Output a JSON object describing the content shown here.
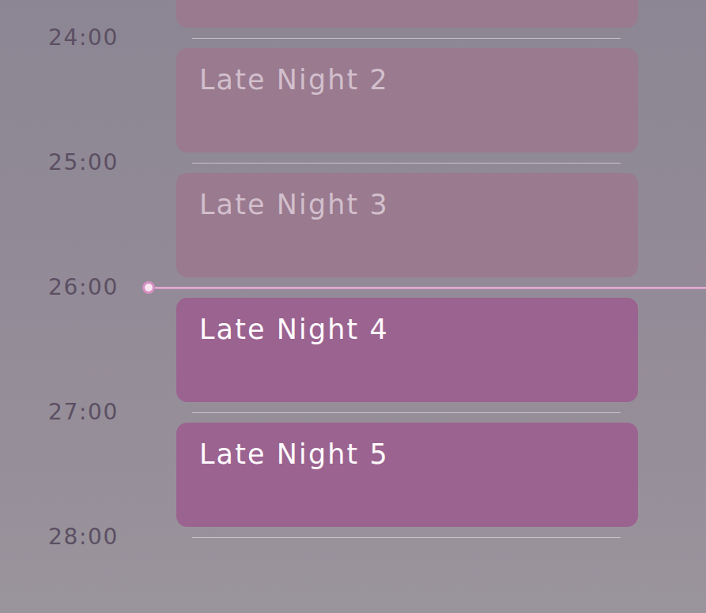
{
  "timeline": {
    "hours": [
      {
        "label": "24:00",
        "current": false
      },
      {
        "label": "25:00",
        "current": false
      },
      {
        "label": "26:00",
        "current": true
      },
      {
        "label": "27:00",
        "current": false
      },
      {
        "label": "28:00",
        "current": false
      }
    ],
    "events": [
      {
        "title": "",
        "past": true
      },
      {
        "title": "Late Night 2",
        "past": true
      },
      {
        "title": "Late Night 3",
        "past": true
      },
      {
        "title": "Late Night 4",
        "past": false
      },
      {
        "title": "Late Night 5",
        "past": false
      }
    ]
  }
}
